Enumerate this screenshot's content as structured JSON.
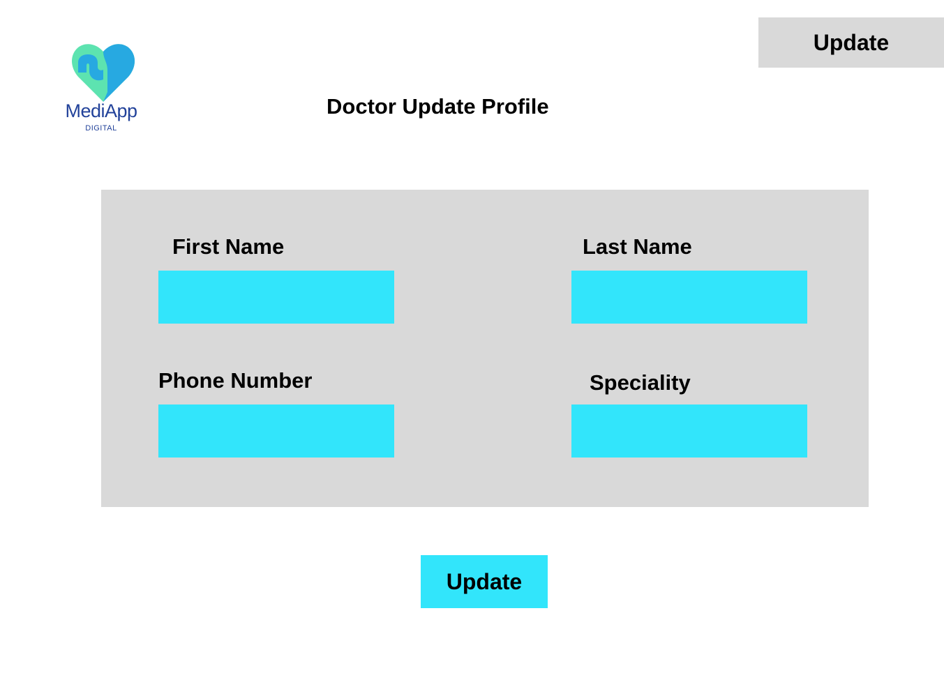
{
  "header": {
    "logo": {
      "name": "MediApp",
      "tagline": "DIGITAL",
      "colors": {
        "heart_green": "#5de3b0",
        "heart_blue": "#27a9e1",
        "text": "#22429a"
      }
    },
    "top_button_label": "Update",
    "title": "Doctor Update Profile"
  },
  "form": {
    "first_name": {
      "label": "First Name",
      "value": ""
    },
    "last_name": {
      "label": "Last Name",
      "value": ""
    },
    "phone_number": {
      "label": "Phone Number",
      "value": ""
    },
    "speciality": {
      "label": "Speciality",
      "value": ""
    }
  },
  "submit_label": "Update",
  "colors": {
    "panel": "#d9d9d9",
    "accent": "#32e5fb",
    "top_button": "#d9d9d9"
  }
}
